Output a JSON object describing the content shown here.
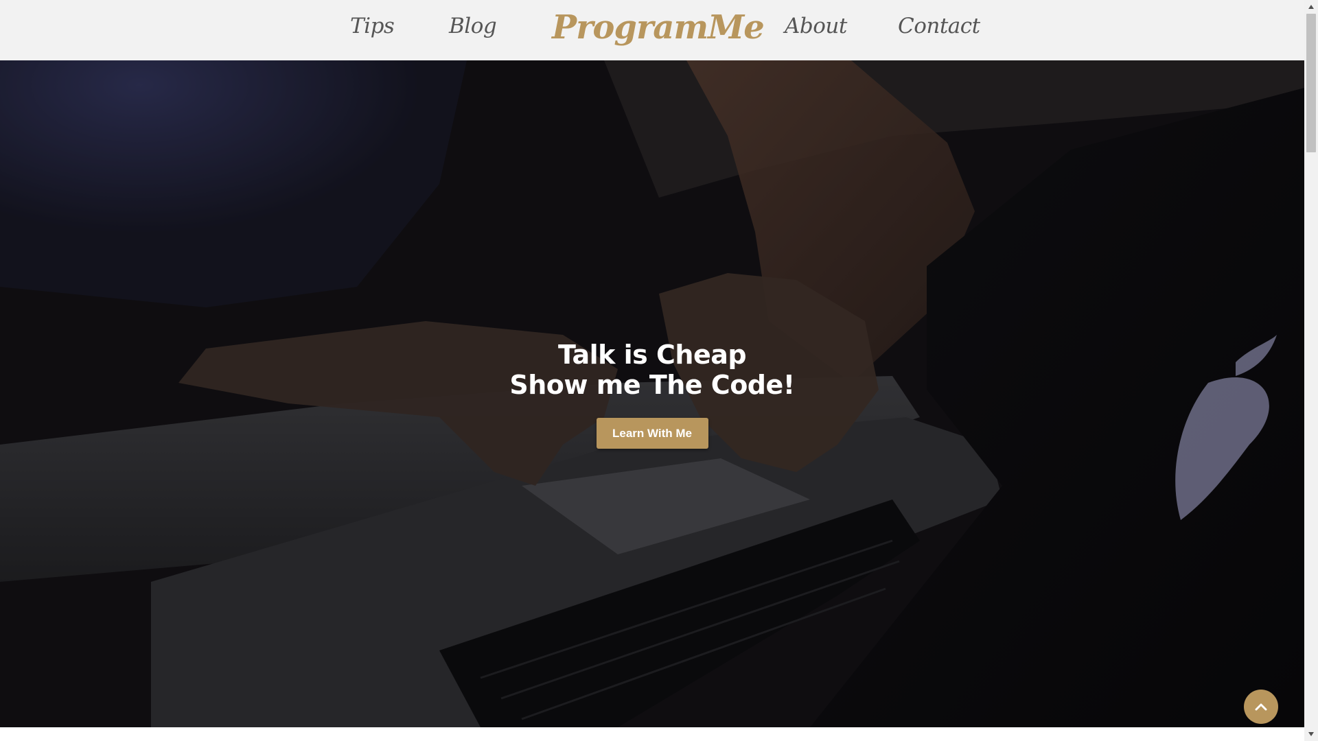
{
  "nav": {
    "brand": "ProgramMe",
    "links": [
      "Tips",
      "Blog",
      "About",
      "Contact"
    ]
  },
  "hero": {
    "title_line1": "Talk is Cheap",
    "title_line2": "Show me The Code!",
    "cta_label": "Learn With Me"
  },
  "icons": {
    "scroll_top": "chevron-up-icon",
    "scrollbar_up": "triangle-up-icon",
    "scrollbar_down": "triangle-down-icon"
  },
  "colors": {
    "accent": "#b8965d",
    "nav_bg": "#f2f2f2",
    "nav_text": "#555555",
    "hero_text": "#ffffff"
  }
}
